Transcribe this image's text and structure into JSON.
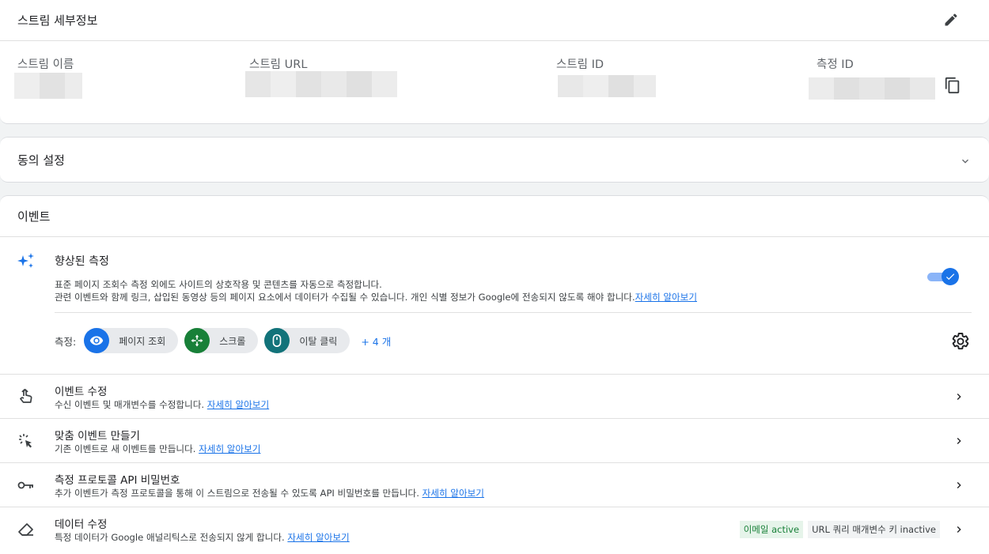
{
  "details": {
    "title": "스트림 세부정보",
    "fields": {
      "name_label": "스트림 이름",
      "url_label": "스트림 URL",
      "id_label": "스트림 ID",
      "measurement_label": "측정 ID"
    }
  },
  "consent": {
    "title": "동의 설정"
  },
  "events": {
    "title": "이벤트",
    "enhanced": {
      "title": "향상된 측정",
      "desc_line1": "표준 페이지 조회수 측정 외에도 사이트의 상호작용 및 콘텐츠를 자동으로 측정합니다.",
      "desc_line2": "관련 이벤트와 함께 링크, 삽입된 동영상 등의 페이지 요소에서 데이터가 수집될 수 있습니다. 개인 식별 정보가 Google에 전송되지 않도록 해야 합니다.",
      "learn_more": "자세히 알아보기",
      "toggle_on": true,
      "measure_label": "측정:",
      "chips": [
        {
          "label": "페이지 조회",
          "icon": "eye-icon",
          "color": "#1a73e8"
        },
        {
          "label": "스크롤",
          "icon": "scroll-arrows-icon",
          "color": "#188038"
        },
        {
          "label": "이탈 클릭",
          "icon": "mouse-icon",
          "color": "#12737a"
        }
      ],
      "more": "+ 4 개"
    },
    "rows": [
      {
        "title": "이벤트 수정",
        "desc": "수신 이벤트 및 매개변수를 수정합니다.",
        "link": "자세히 알아보기",
        "icon": "touch-hand-icon"
      },
      {
        "title": "맞춤 이벤트 만들기",
        "desc": "기존 이벤트로 새 이벤트를 만듭니다.",
        "link": "자세히 알아보기",
        "icon": "cursor-click-icon"
      },
      {
        "title": "측정 프로토콜 API 비밀번호",
        "desc": "추가 이벤트가 측정 프로토콜을 통해 이 스트림으로 전송될 수 있도록 API 비밀번호를 만듭니다.",
        "link": "자세히 알아보기",
        "icon": "key-icon"
      },
      {
        "title": "데이터 수정",
        "desc": "특정 데이터가 Google 애널리틱스로 전송되지 않게 합니다.",
        "link": "자세히 알아보기",
        "icon": "eraser-icon",
        "badges": {
          "active": "이메일 active",
          "inactive": "URL 쿼리 매개변수 키 inactive"
        }
      }
    ]
  },
  "colors": {
    "accent": "#1a73e8",
    "active_bg": "#e6f4ea",
    "active_text": "#188038"
  }
}
